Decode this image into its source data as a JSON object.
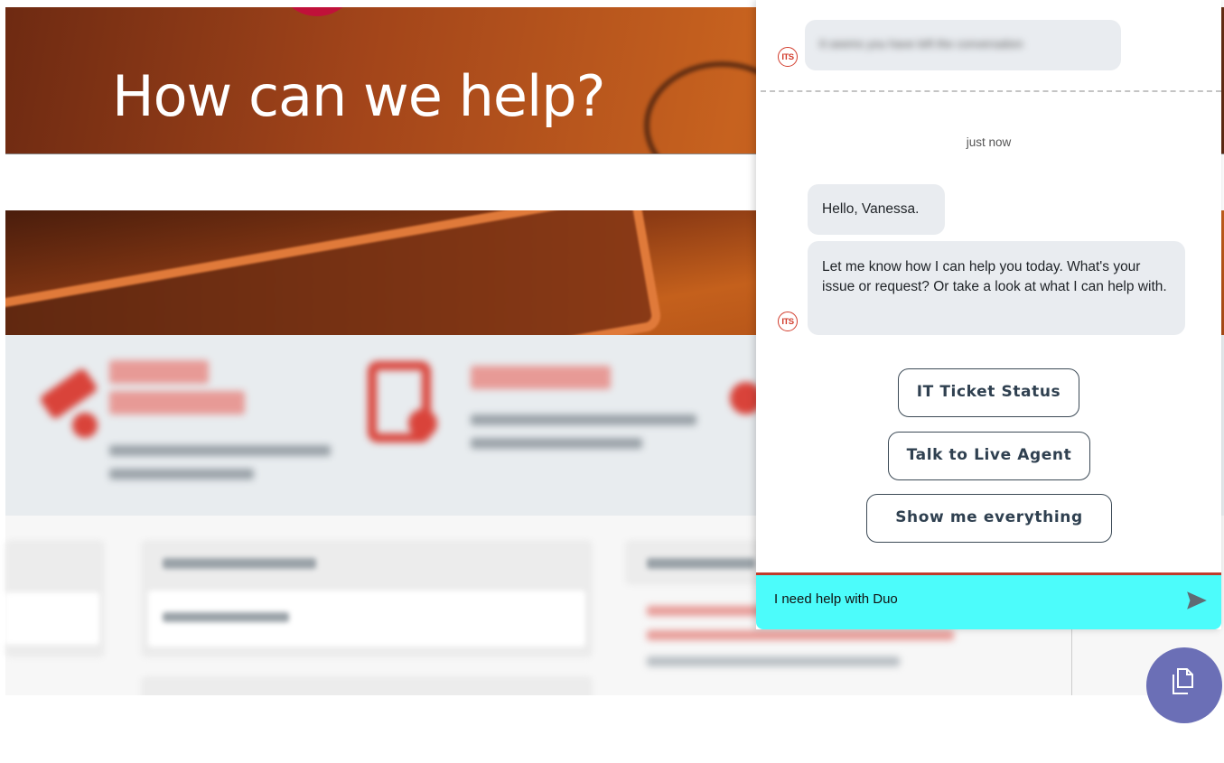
{
  "hero": {
    "title": "How can we help?"
  },
  "chat": {
    "previous_message": "It seems you have left the conversation",
    "timestamp": "just now",
    "greeting": "Hello, Vanessa.",
    "prompt": "Let me know how I can help you today. What's your issue or request? Or take a look at what I can help with.",
    "avatar_label": "ITS",
    "options": [
      "IT Ticket Status",
      "Talk to Live Agent",
      "Show me everything"
    ],
    "input_value": "I need help with Duo"
  },
  "icons": {
    "send": "send-icon",
    "fab": "document-icon"
  },
  "colors": {
    "input_bg": "#4cfcfb",
    "input_border": "#c03a2b",
    "accent_red": "#d23b2b",
    "fab_bg": "#6b6fb6",
    "bubble_bg": "#e9ecf0"
  }
}
